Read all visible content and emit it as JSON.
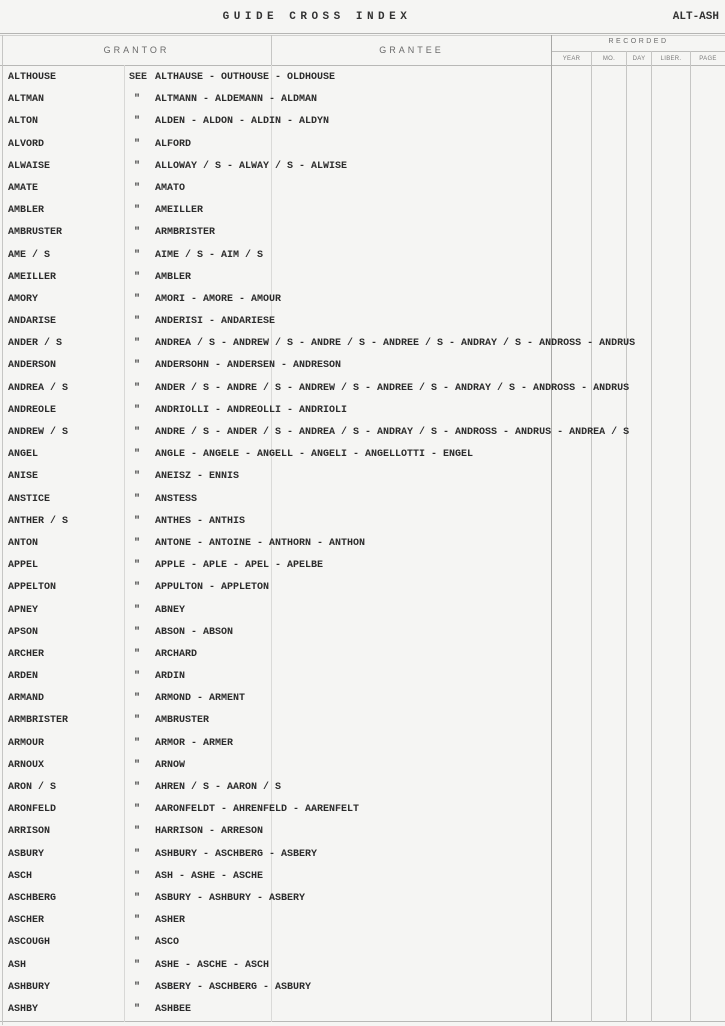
{
  "header": {
    "title": "GUIDE CROSS INDEX",
    "range": "ALT-ASH",
    "columns": {
      "grantor": "GRANTOR",
      "grantee": "GRANTEE",
      "recorded": "RECORDED",
      "recorded_sub": [
        "YEAR",
        "MO.",
        "DAY",
        "LIBER.",
        "PAGE"
      ]
    }
  },
  "entries": [
    {
      "grantor": "ALTHOUSE",
      "prefix": "SEE",
      "grantee": "ALTHAUSE - OUTHOUSE - OLDHOUSE"
    },
    {
      "grantor": "ALTMAN",
      "prefix": "\"",
      "grantee": "ALTMANN - ALDEMANN - ALDMAN"
    },
    {
      "grantor": "ALTON",
      "prefix": "\"",
      "grantee": "ALDEN - ALDON - ALDIN - ALDYN"
    },
    {
      "grantor": "ALVORD",
      "prefix": "\"",
      "grantee": "ALFORD"
    },
    {
      "grantor": "ALWAISE",
      "prefix": "\"",
      "grantee": "ALLOWAY / S - ALWAY / S - ALWISE"
    },
    {
      "grantor": "AMATE",
      "prefix": "\"",
      "grantee": "AMATO"
    },
    {
      "grantor": "AMBLER",
      "prefix": "\"",
      "grantee": "AMEILLER"
    },
    {
      "grantor": "AMBRUSTER",
      "prefix": "\"",
      "grantee": "ARMBRISTER"
    },
    {
      "grantor": "AME / S",
      "prefix": "\"",
      "grantee": "AIME / S - AIM / S"
    },
    {
      "grantor": "AMEILLER",
      "prefix": "\"",
      "grantee": "AMBLER"
    },
    {
      "grantor": "AMORY",
      "prefix": "\"",
      "grantee": "AMORI - AMORE - AMOUR"
    },
    {
      "grantor": "ANDARISE",
      "prefix": "\"",
      "grantee": "ANDERISI - ANDARIESE"
    },
    {
      "grantor": "ANDER / S",
      "prefix": "\"",
      "grantee": "ANDREA / S - ANDREW / S - ANDRE / S - ANDREE / S - ANDRAY / S - ANDROSS - ANDRUS"
    },
    {
      "grantor": "ANDERSON",
      "prefix": "\"",
      "grantee": "ANDERSOHN - ANDERSEN - ANDRESON"
    },
    {
      "grantor": "ANDREA / S",
      "prefix": "\"",
      "grantee": "ANDER / S - ANDRE / S - ANDREW / S - ANDREE / S - ANDRAY / S - ANDROSS - ANDRUS"
    },
    {
      "grantor": "ANDREOLE",
      "prefix": "\"",
      "grantee": "ANDRIOLLI - ANDREOLLI - ANDRIOLI"
    },
    {
      "grantor": "ANDREW / S",
      "prefix": "\"",
      "grantee": "ANDRE / S - ANDER / S - ANDREA / S - ANDRAY / S - ANDROSS - ANDRUS - ANDREA / S"
    },
    {
      "grantor": "ANGEL",
      "prefix": "\"",
      "grantee": "ANGLE - ANGELE - ANGELL - ANGELI - ANGELLOTTI - ENGEL"
    },
    {
      "grantor": "ANISE",
      "prefix": "\"",
      "grantee": "ANEISZ - ENNIS"
    },
    {
      "grantor": "ANSTICE",
      "prefix": "\"",
      "grantee": "ANSTESS"
    },
    {
      "grantor": "ANTHER / S",
      "prefix": "\"",
      "grantee": "ANTHES - ANTHIS"
    },
    {
      "grantor": "ANTON",
      "prefix": "\"",
      "grantee": "ANTONE - ANTOINE - ANTHORN - ANTHON"
    },
    {
      "grantor": "APPEL",
      "prefix": "\"",
      "grantee": "APPLE - APLE - APEL - APELBE"
    },
    {
      "grantor": "APPELTON",
      "prefix": "\"",
      "grantee": "APPULTON - APPLETON"
    },
    {
      "grantor": "APNEY",
      "prefix": "\"",
      "grantee": "ABNEY"
    },
    {
      "grantor": "APSON",
      "prefix": "\"",
      "grantee": "ABSON - ABSON"
    },
    {
      "grantor": "ARCHER",
      "prefix": "\"",
      "grantee": "ARCHARD"
    },
    {
      "grantor": "ARDEN",
      "prefix": "\"",
      "grantee": "ARDIN"
    },
    {
      "grantor": "ARMAND",
      "prefix": "\"",
      "grantee": "ARMOND - ARMENT"
    },
    {
      "grantor": "ARMBRISTER",
      "prefix": "\"",
      "grantee": "AMBRUSTER"
    },
    {
      "grantor": "ARMOUR",
      "prefix": "\"",
      "grantee": "ARMOR - ARMER"
    },
    {
      "grantor": "ARNOUX",
      "prefix": "\"",
      "grantee": "ARNOW"
    },
    {
      "grantor": "ARON / S",
      "prefix": "\"",
      "grantee": "AHREN / S - AARON / S"
    },
    {
      "grantor": "ARONFELD",
      "prefix": "\"",
      "grantee": "AARONFELDT - AHRENFELD - AARENFELT"
    },
    {
      "grantor": "ARRISON",
      "prefix": "\"",
      "grantee": "HARRISON - ARRESON"
    },
    {
      "grantor": "ASBURY",
      "prefix": "\"",
      "grantee": "ASHBURY - ASCHBERG - ASBERY"
    },
    {
      "grantor": "ASCH",
      "prefix": "\"",
      "grantee": "ASH - ASHE - ASCHE"
    },
    {
      "grantor": "ASCHBERG",
      "prefix": "\"",
      "grantee": "ASBURY - ASHBURY - ASBERY"
    },
    {
      "grantor": "ASCHER",
      "prefix": "\"",
      "grantee": "ASHER"
    },
    {
      "grantor": "ASCOUGH",
      "prefix": "\"",
      "grantee": "ASCO"
    },
    {
      "grantor": "ASH",
      "prefix": "\"",
      "grantee": "ASHE - ASCHE - ASCH"
    },
    {
      "grantor": "ASHBURY",
      "prefix": "\"",
      "grantee": "ASBERY - ASCHBERG - ASBURY"
    },
    {
      "grantor": "ASHBY",
      "prefix": "\"",
      "grantee": "ASHBEE"
    }
  ]
}
